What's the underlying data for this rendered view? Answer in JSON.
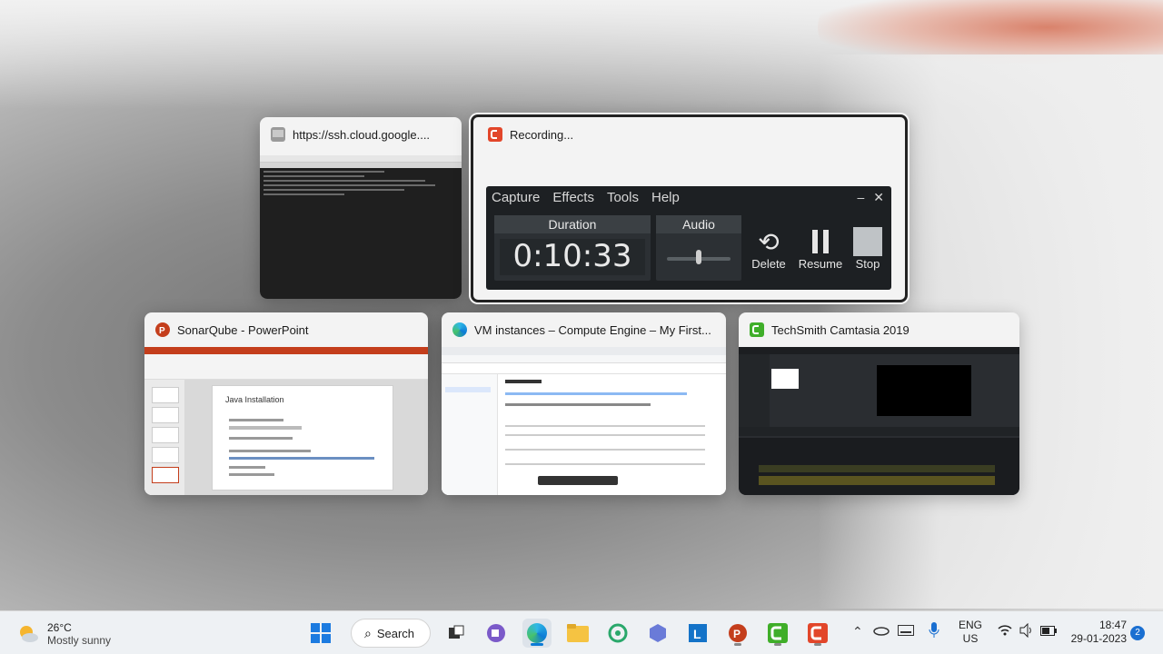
{
  "windows": [
    {
      "title": "https://ssh.cloud.google...."
    },
    {
      "title": "Recording..."
    },
    {
      "title": "SonarQube - PowerPoint"
    },
    {
      "title": "VM instances – Compute Engine – My First..."
    },
    {
      "title": "TechSmith Camtasia 2019"
    }
  ],
  "recorder": {
    "menu": [
      "Capture",
      "Effects",
      "Tools",
      "Help"
    ],
    "duration_label": "Duration",
    "duration_value": "0:10:33",
    "audio_label": "Audio",
    "delete_label": "Delete",
    "resume_label": "Resume",
    "stop_label": "Stop"
  },
  "slide": {
    "title": "Java Installation"
  },
  "taskbar": {
    "weather_temp": "26°C",
    "weather_desc": "Mostly sunny",
    "search_label": "Search",
    "lang": "ENG",
    "region": "US",
    "time": "18:47",
    "date": "29-01-2023",
    "notification_count": "2"
  },
  "colors": {
    "powerpoint": "#c43e1c",
    "camtasia_green": "#3fae29",
    "recorder_red": "#e2462a",
    "edge_blue": "#0c7bd6"
  },
  "icons": [
    "terminal-icon",
    "camtasia-recorder-icon",
    "powerpoint-icon",
    "edge-icon",
    "camtasia-icon",
    "weather-icon",
    "windows-start-icon",
    "search-icon",
    "task-view-icon",
    "teams-icon",
    "edge-icon",
    "file-explorer-icon",
    "qlik-icon",
    "copilot-icon",
    "learn-icon",
    "powerpoint-icon",
    "camtasia-icon",
    "camtasia-recorder-icon",
    "chevron-up-icon",
    "onedrive-icon",
    "keyboard-icon",
    "microphone-icon",
    "wifi-icon",
    "volume-icon",
    "battery-icon"
  ]
}
